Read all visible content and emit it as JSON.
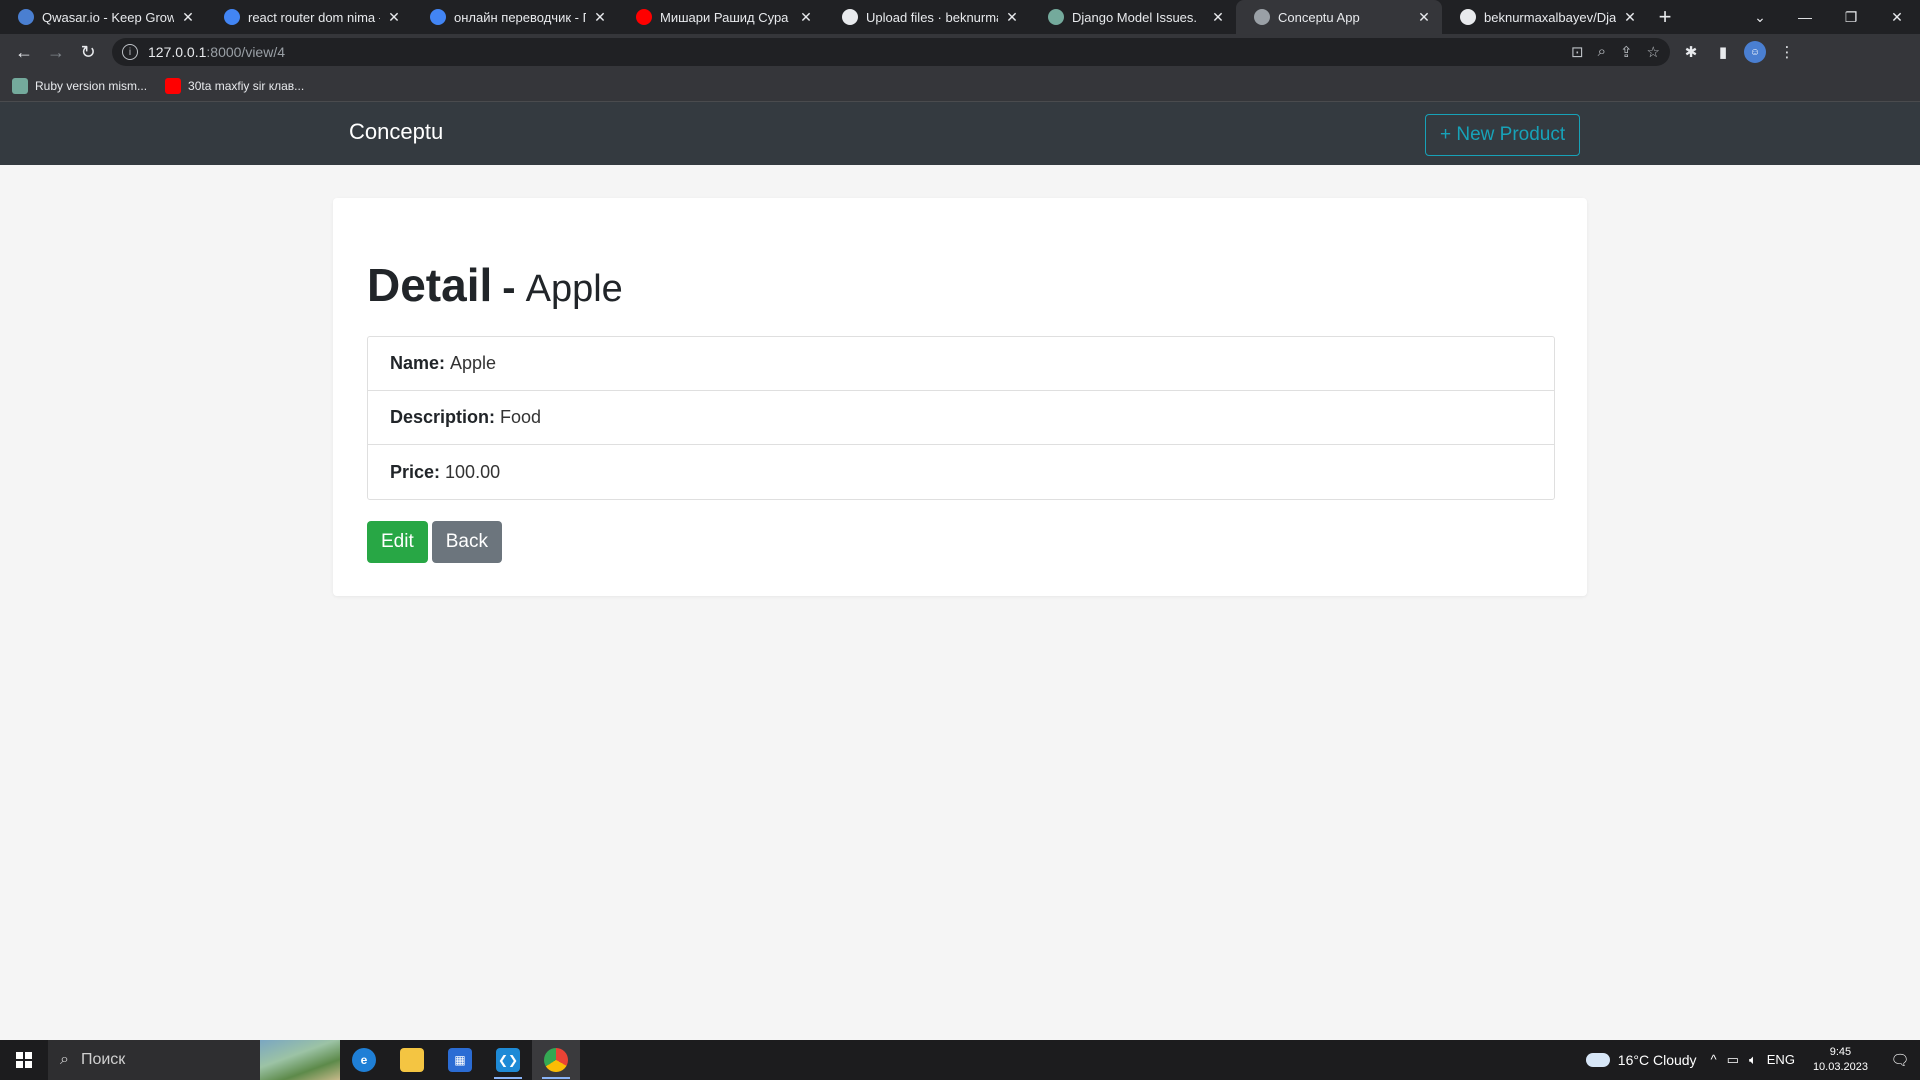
{
  "browser": {
    "tabs": [
      {
        "title": "Qwasar.io - Keep Growing",
        "favicon": "qwasar-icon",
        "color": "#4a7fd1"
      },
      {
        "title": "react router dom nima - Поиск",
        "favicon": "google-icon",
        "color": "#4285f4"
      },
      {
        "title": "онлайн переводчик - Поиск",
        "favicon": "google-icon",
        "color": "#4285f4"
      },
      {
        "title": "Мишари Рашид Сура Ясин",
        "favicon": "youtube-icon",
        "color": "#ff0000"
      },
      {
        "title": "Upload files · beknurmaxalbayev",
        "favicon": "github-icon",
        "color": "#e8eaed"
      },
      {
        "title": "Django Model Issues.",
        "favicon": "chatgpt-icon",
        "color": "#74aa9c"
      },
      {
        "title": "Conceptu App",
        "favicon": "globe-icon",
        "color": "#9aa0a6",
        "active": true
      },
      {
        "title": "beknurmaxalbayev/Django",
        "favicon": "github-icon",
        "color": "#e8eaed"
      }
    ],
    "url_host": "127.0.0.1",
    "url_path": ":8000/view/4",
    "bookmarks": [
      {
        "label": "Ruby version mism...",
        "favicon": "chatgpt-icon",
        "color": "#74aa9c"
      },
      {
        "label": "30ta maxfiy sir клав...",
        "favicon": "youtube-icon",
        "color": "#ff0000"
      }
    ]
  },
  "app": {
    "brand": "Conceptu",
    "new_product_label": "+ New Product",
    "heading_main": "Detail",
    "heading_sep": "-",
    "heading_sub": "Apple",
    "fields": [
      {
        "label": "Name:",
        "value": "Apple"
      },
      {
        "label": "Description:",
        "value": "Food"
      },
      {
        "label": "Price:",
        "value": "100.00"
      }
    ],
    "edit_label": "Edit",
    "back_label": "Back"
  },
  "taskbar": {
    "search_placeholder": "Поиск",
    "weather": "16°C  Cloudy",
    "lang": "ENG",
    "time": "9:45",
    "date": "10.03.2023"
  }
}
